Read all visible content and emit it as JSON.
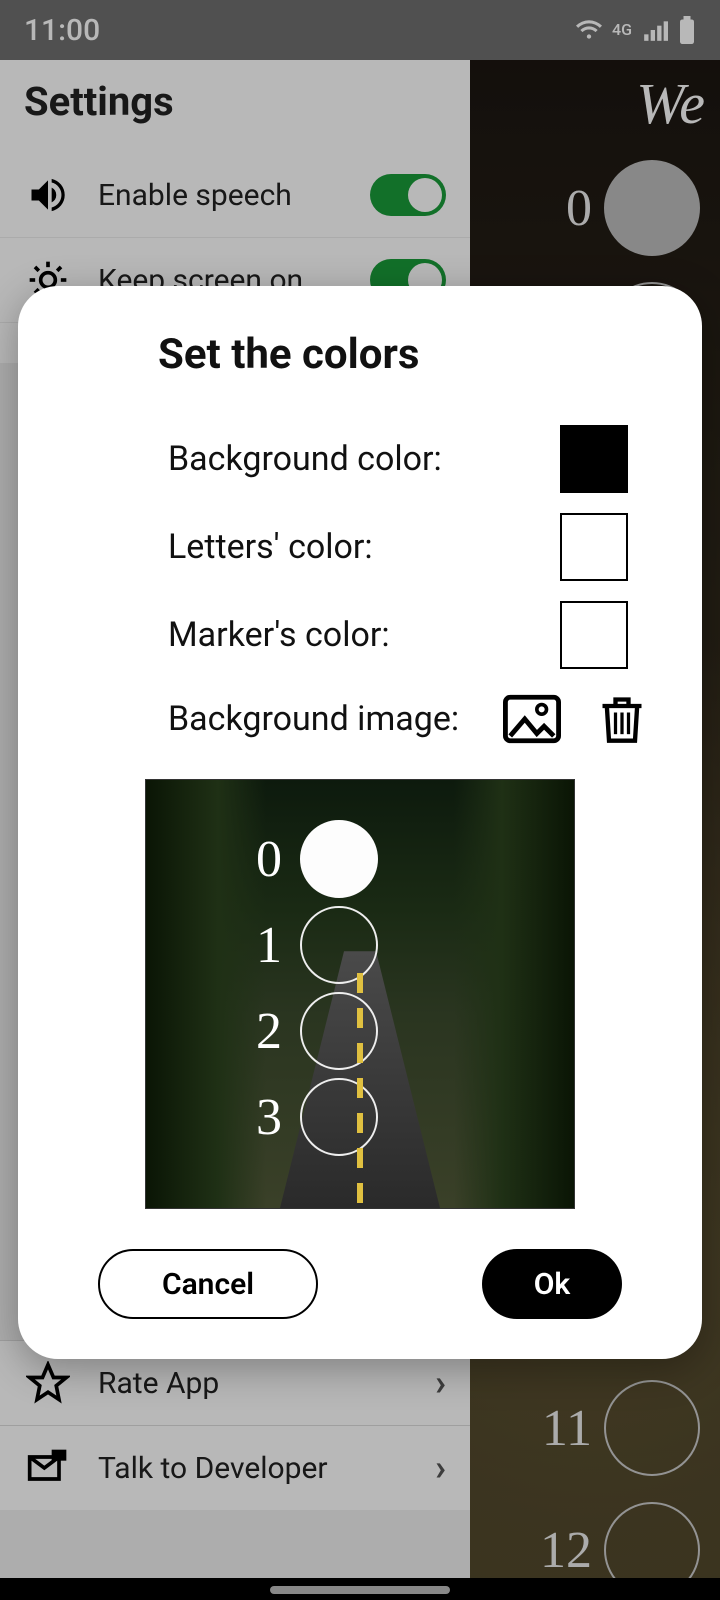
{
  "status": {
    "time": "11:00",
    "net": "4G"
  },
  "settings": {
    "title": "Settings",
    "enable_speech": "Enable speech",
    "keep_screen": "Keep screen on",
    "rate_app": "Rate App",
    "talk_dev": "Talk to Developer"
  },
  "bg_strip": {
    "header": "We",
    "nums": [
      "0",
      "",
      "",
      "",
      "",
      "",
      "",
      "",
      "",
      "",
      "11",
      "12"
    ]
  },
  "dialog": {
    "title": "Set the colors",
    "bg_color": "Background color:",
    "letters_color": "Letters' color:",
    "marker_color": "Marker's color:",
    "bg_image": "Background image:",
    "preview_nums": [
      "0",
      "1",
      "2",
      "3"
    ],
    "cancel": "Cancel",
    "ok": "Ok",
    "swatches": {
      "background": "#000000",
      "letters": "#ffffff",
      "marker": "#ffffff"
    }
  }
}
